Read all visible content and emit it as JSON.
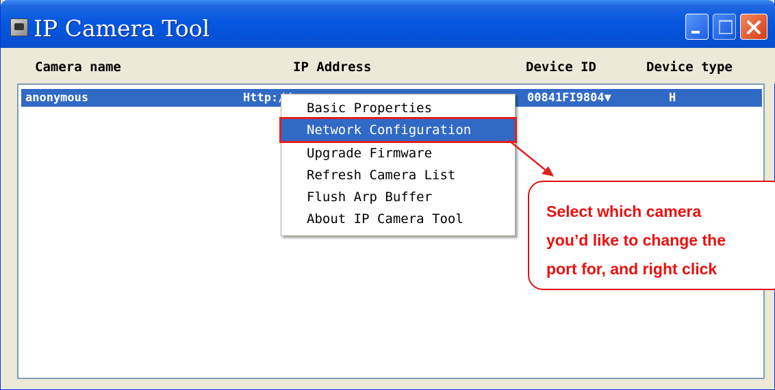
{
  "window": {
    "title": "IP Camera Tool",
    "icon": "camera-app-icon",
    "controls": [
      "minimize-icon",
      "maximize-icon",
      "close-icon"
    ]
  },
  "columns": {
    "camera_name": "Camera name",
    "ip_address": "IP Address",
    "device_id": "Device ID",
    "device_type": "Device type"
  },
  "camera_list": [
    {
      "name": "anonymous",
      "ip_address": "Http://",
      "device_id": "00841FI9804▼",
      "device_type": "H",
      "selected": true
    }
  ],
  "context_menu": {
    "items": [
      {
        "label": "Basic Properties",
        "highlighted": false
      },
      {
        "label": "Network Configuration",
        "highlighted": true
      },
      {
        "label": "Upgrade Firmware",
        "highlighted": false
      },
      {
        "label": "Refresh Camera List",
        "highlighted": false
      },
      {
        "label": "Flush Arp Buffer",
        "highlighted": false
      },
      {
        "label": "About IP Camera Tool",
        "highlighted": false
      }
    ]
  },
  "callout": {
    "lines": [
      "Select which camera",
      "you’d like to change the",
      "port for, and right click"
    ],
    "color": "#e8110f"
  },
  "colors": {
    "titlebar": "#0758e0",
    "selection": "#316ac5",
    "annotation_red": "#e02020"
  }
}
